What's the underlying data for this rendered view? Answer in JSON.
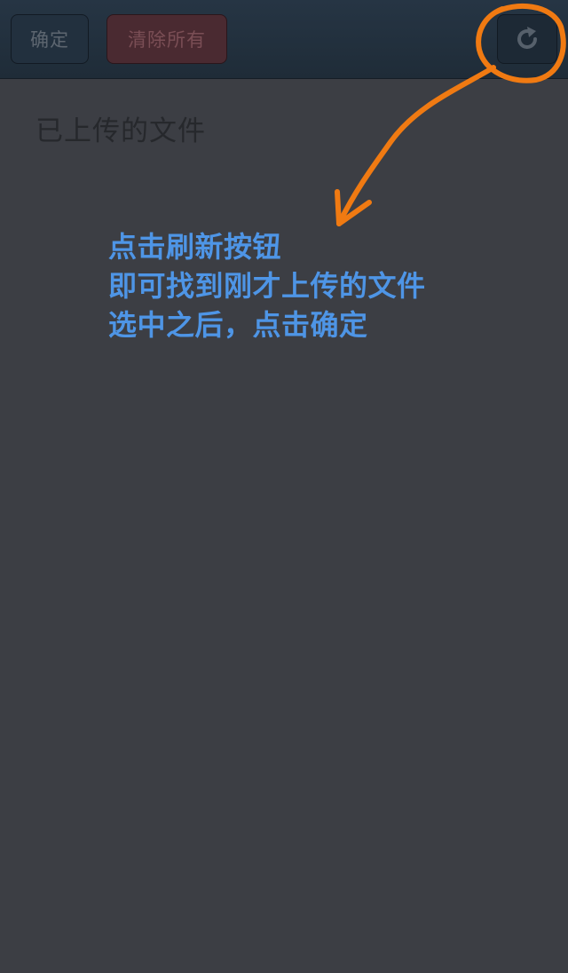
{
  "toolbar": {
    "confirm_label": "确定",
    "clear_all_label": "清除所有",
    "refresh_icon": "refresh-icon"
  },
  "main": {
    "section_title": "已上传的文件"
  },
  "annotation": {
    "lines": [
      "点击刷新按钮",
      "即可找到刚才上传的文件",
      "选中之后，点击确定"
    ],
    "color": "#4e95e6",
    "highlight_color": "#f07a12"
  }
}
